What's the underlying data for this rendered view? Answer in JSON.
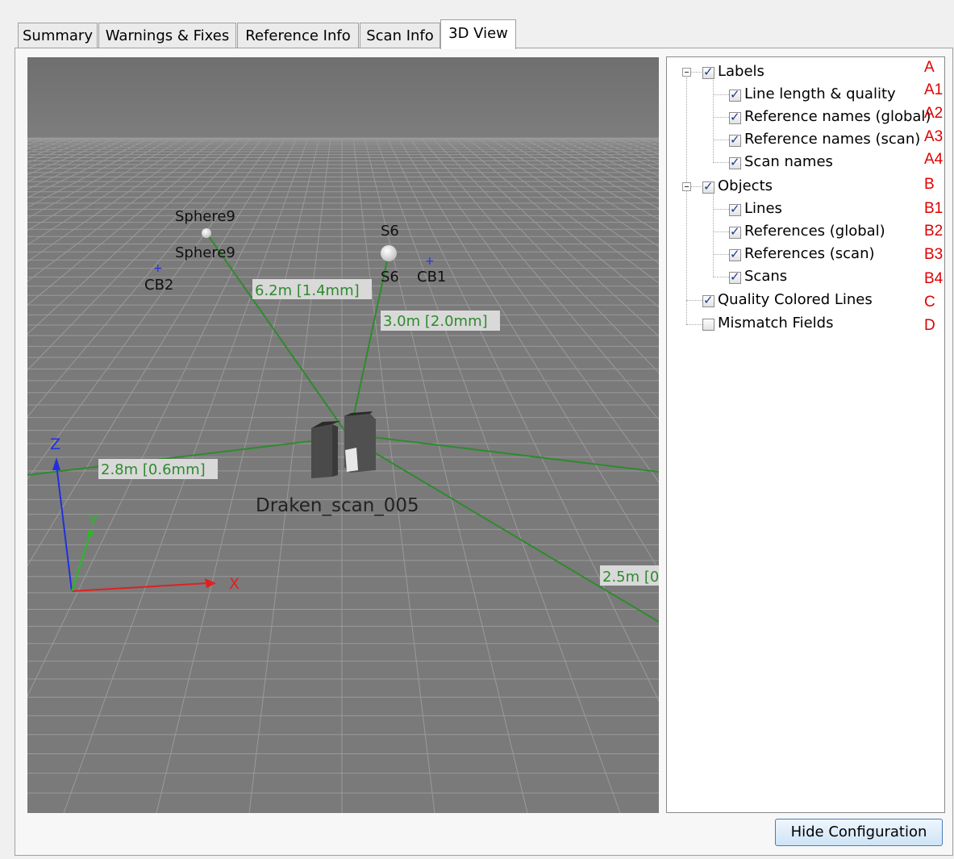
{
  "tabs": [
    "Summary",
    "Warnings & Fixes",
    "Reference Info",
    "Scan Info",
    "3D View"
  ],
  "active_tab": "3D View",
  "viewport": {
    "references": {
      "sphere9_top": "Sphere9",
      "sphere9_bottom": "Sphere9",
      "s6_top": "S6",
      "s6_bottom": "S6",
      "cb2": "CB2",
      "cb1": "CB1"
    },
    "lines": {
      "line_sphere9": "6.2m [1.4mm]",
      "line_s6": "3.0m [2.0mm]",
      "line_left": "2.8m [0.6mm]",
      "line_right": "2.5m [0"
    },
    "scan_name": "Draken_scan_005",
    "axes": {
      "x": "X",
      "y": "Y",
      "z": "Z"
    },
    "colors": {
      "quality_line": "#2f8a2f",
      "label_bg": "#d9d9d9",
      "axis_x": "#e02020",
      "axis_y": "#20c020",
      "axis_z": "#2030e0"
    }
  },
  "tree": {
    "labels": "Labels",
    "labels_children": [
      "Line length & quality",
      "Reference names (global)",
      "Reference names (scan)",
      "Scan names"
    ],
    "objects": "Objects",
    "objects_children": [
      "Lines",
      "References (global)",
      "References (scan)",
      "Scans"
    ],
    "quality": "Quality Colored Lines",
    "mismatch": "Mismatch Fields"
  },
  "annotations": [
    "A",
    "A1",
    "A2",
    "A3",
    "A4",
    "B",
    "B1",
    "B2",
    "B3",
    "B4",
    "C",
    "D"
  ],
  "hide_button": "Hide Configuration"
}
